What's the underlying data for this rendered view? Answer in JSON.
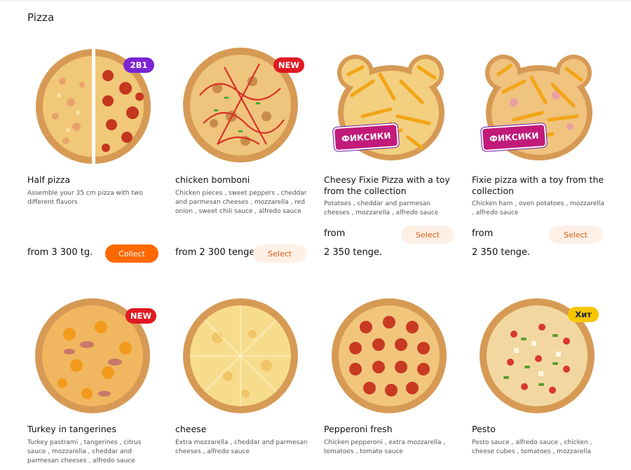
{
  "section": {
    "title": "Pizza"
  },
  "colors": {
    "primary_button": "#ff6900",
    "light_button": "#fff0e6",
    "badge_2b1": "#7b25d4",
    "badge_new": "#e01a22",
    "badge_hit": "#f7c600"
  },
  "products": [
    {
      "name": "Half pizza",
      "desc": "Assemble your 35 cm pizza with two different flavors",
      "price": "from 3 300 tg.",
      "button": "Collect",
      "badge": "2В1",
      "image": "half-half-pizza"
    },
    {
      "name": "chicken bomboni",
      "desc": "Chicken pieces , sweet peppers , cheddar and parmesan cheeses , mozzarella , red onion , sweet chili sauce , alfredo sauce",
      "price": "from 2 300 tenge",
      "button": "Select",
      "badge": "NEW",
      "image": "chicken-bomboni-pizza"
    },
    {
      "name": "Cheesy Fixie Pizza with a toy from the collection",
      "desc": "Potatoes , cheddar and parmesan cheeses , mozzarella , alfredo sauce",
      "price_from": "from",
      "price_value": "2 350 tenge.",
      "button": "Select",
      "logo": "ФИКСИКИ",
      "image": "bear-shaped-fries-pizza"
    },
    {
      "name": "Fixie pizza with a toy from the collection",
      "desc": "Chicken ham , oven potatoes , mozzarella , alfredo sauce",
      "price_from": "from",
      "price_value": "2 350 tenge.",
      "button": "Select",
      "logo": "ФИКСИКИ",
      "image": "bear-shaped-ham-pizza"
    },
    {
      "name": "Turkey in tangerines",
      "desc": "Turkey pastrami , tangerines , citrus sauce , mozzarella , cheddar and parmesan cheeses , alfredo sauce",
      "badge": "NEW",
      "image": "turkey-tangerine-pizza"
    },
    {
      "name": "cheese",
      "desc": "Extra mozzarella , cheddar and parmesan cheeses , alfredo sauce",
      "image": "cheese-pizza"
    },
    {
      "name": "Pepperoni fresh",
      "desc": "Chicken pepperoni , extra mozzarella , tomatoes , tomato sauce",
      "image": "pepperoni-pizza"
    },
    {
      "name": "Pesto",
      "desc": "Pesto sauce , alfredo sauce , chicken , cheese cubes , tomatoes , mozzarella",
      "badge": "Хит",
      "image": "pesto-pizza"
    }
  ]
}
